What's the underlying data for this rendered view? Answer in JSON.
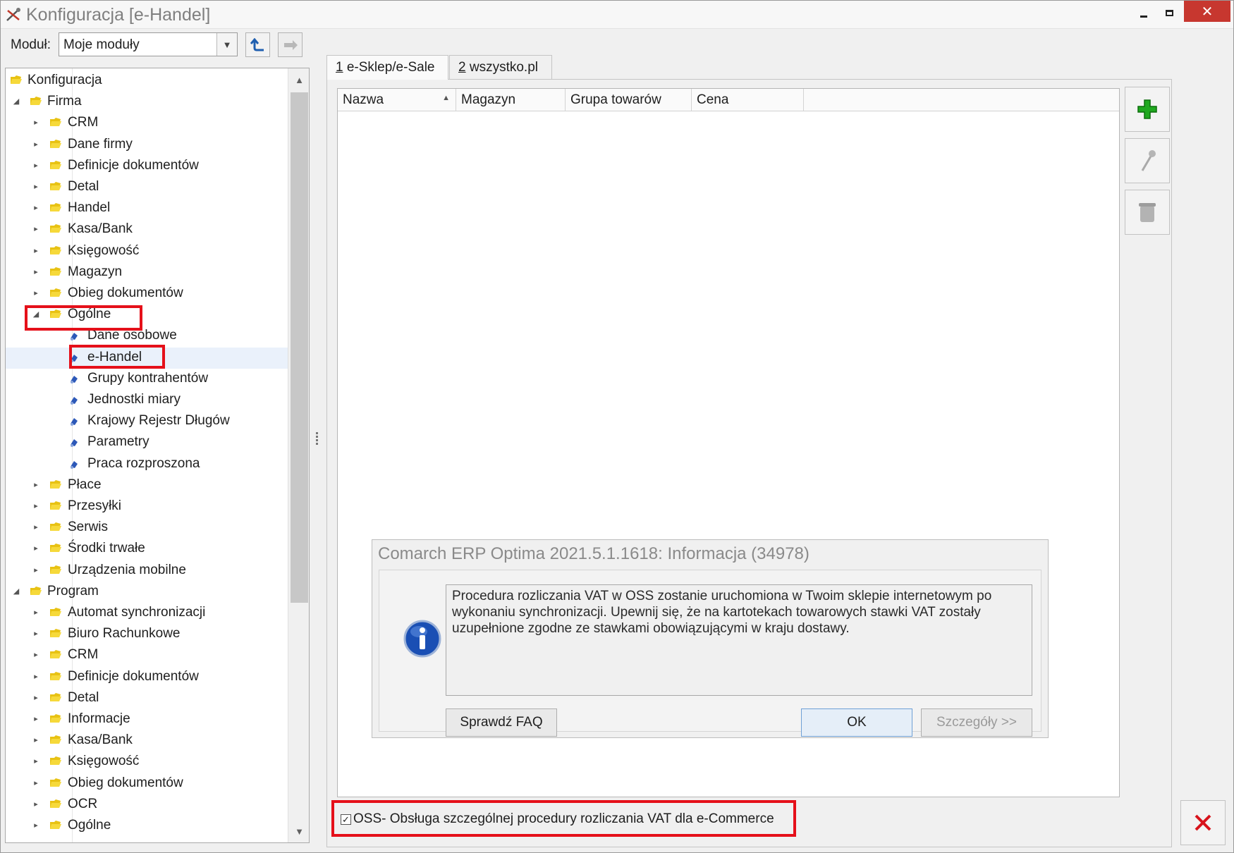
{
  "window": {
    "title": "Konfiguracja [e-Handel]",
    "icon": "tools-icon",
    "controls": [
      "minimize",
      "maximize",
      "close"
    ],
    "close_color": "#c7372f"
  },
  "module": {
    "label": "Moduł:",
    "selected": "Moje moduły"
  },
  "tree": {
    "items": [
      {
        "label": "Konfiguracja",
        "level": 0,
        "expander": "",
        "icon": "folder-icon"
      },
      {
        "label": "Firma",
        "level": 1,
        "expander": "expanded",
        "icon": "folder-icon"
      },
      {
        "label": "CRM",
        "level": 2,
        "expander": "collapsed",
        "icon": "folder-icon"
      },
      {
        "label": "Dane firmy",
        "level": 2,
        "expander": "collapsed",
        "icon": "folder-icon"
      },
      {
        "label": "Definicje dokumentów",
        "level": 2,
        "expander": "collapsed",
        "icon": "folder-icon"
      },
      {
        "label": "Detal",
        "level": 2,
        "expander": "collapsed",
        "icon": "folder-icon"
      },
      {
        "label": "Handel",
        "level": 2,
        "expander": "collapsed",
        "icon": "folder-icon"
      },
      {
        "label": "Kasa/Bank",
        "level": 2,
        "expander": "collapsed",
        "icon": "folder-icon"
      },
      {
        "label": "Księgowość",
        "level": 2,
        "expander": "collapsed",
        "icon": "folder-icon"
      },
      {
        "label": "Magazyn",
        "level": 2,
        "expander": "collapsed",
        "icon": "folder-icon"
      },
      {
        "label": "Obieg dokumentów",
        "level": 2,
        "expander": "collapsed",
        "icon": "folder-icon"
      },
      {
        "label": "Ogólne",
        "level": 2,
        "expander": "expanded",
        "icon": "folder-icon"
      },
      {
        "label": "Dane osobowe",
        "level": 3,
        "expander": "",
        "icon": "leaf-icon"
      },
      {
        "label": "e-Handel",
        "level": 3,
        "expander": "",
        "icon": "leaf-icon",
        "selected": true
      },
      {
        "label": "Grupy kontrahentów",
        "level": 3,
        "expander": "",
        "icon": "leaf-icon"
      },
      {
        "label": "Jednostki miary",
        "level": 3,
        "expander": "",
        "icon": "leaf-icon"
      },
      {
        "label": "Krajowy Rejestr Długów",
        "level": 3,
        "expander": "",
        "icon": "leaf-icon"
      },
      {
        "label": "Parametry",
        "level": 3,
        "expander": "",
        "icon": "leaf-icon"
      },
      {
        "label": "Praca rozproszona",
        "level": 3,
        "expander": "",
        "icon": "leaf-icon"
      },
      {
        "label": "Płace",
        "level": 2,
        "expander": "collapsed",
        "icon": "folder-icon"
      },
      {
        "label": "Przesyłki",
        "level": 2,
        "expander": "collapsed",
        "icon": "folder-icon"
      },
      {
        "label": "Serwis",
        "level": 2,
        "expander": "collapsed",
        "icon": "folder-icon"
      },
      {
        "label": "Środki trwałe",
        "level": 2,
        "expander": "collapsed",
        "icon": "folder-icon"
      },
      {
        "label": "Urządzenia mobilne",
        "level": 2,
        "expander": "collapsed",
        "icon": "folder-icon"
      },
      {
        "label": "Program",
        "level": 1,
        "expander": "expanded",
        "icon": "folder-icon"
      },
      {
        "label": "Automat synchronizacji",
        "level": 2,
        "expander": "collapsed",
        "icon": "folder-icon"
      },
      {
        "label": "Biuro Rachunkowe",
        "level": 2,
        "expander": "collapsed",
        "icon": "folder-icon"
      },
      {
        "label": "CRM",
        "level": 2,
        "expander": "collapsed",
        "icon": "folder-icon"
      },
      {
        "label": "Definicje dokumentów",
        "level": 2,
        "expander": "collapsed",
        "icon": "folder-icon"
      },
      {
        "label": "Detal",
        "level": 2,
        "expander": "collapsed",
        "icon": "folder-icon"
      },
      {
        "label": "Informacje",
        "level": 2,
        "expander": "collapsed",
        "icon": "folder-icon"
      },
      {
        "label": "Kasa/Bank",
        "level": 2,
        "expander": "collapsed",
        "icon": "folder-icon"
      },
      {
        "label": "Księgowość",
        "level": 2,
        "expander": "collapsed",
        "icon": "folder-icon"
      },
      {
        "label": "Obieg dokumentów",
        "level": 2,
        "expander": "collapsed",
        "icon": "folder-icon"
      },
      {
        "label": "OCR",
        "level": 2,
        "expander": "collapsed",
        "icon": "folder-icon"
      },
      {
        "label": "Ogólne",
        "level": 2,
        "expander": "collapsed",
        "icon": "folder-icon"
      }
    ]
  },
  "tabs": [
    {
      "key": "1",
      "label": " e-Sklep/e-Sale",
      "active": true
    },
    {
      "key": "2",
      "label": " wszystko.pl",
      "active": false
    }
  ],
  "grid": {
    "columns": [
      "Nazwa",
      "Magazyn",
      "Grupa towarów",
      "Cena"
    ],
    "sorted_column": "Nazwa",
    "rows": []
  },
  "side_buttons": [
    "add-icon",
    "edit-icon",
    "delete-icon"
  ],
  "oss": {
    "checked": true,
    "label": "OSS- Obsługa szczególnej procedury rozliczania VAT dla e-Commerce"
  },
  "dialog": {
    "title": "Comarch ERP Optima 2021.5.1.1618: Informacja (34978)",
    "icon": "info-icon",
    "message": "Procedura rozliczania VAT w OSS zostanie uruchomiona w Twoim sklepie internetowym po wykonaniu synchronizacji. Upewnij się, że na kartotekach towarowych stawki VAT zostały uzupełnione zgodne ze stawkami obowiązującymi w kraju dostawy.",
    "buttons": {
      "faq": "Sprawdź FAQ",
      "ok": "OK",
      "details": "Szczegóły >>"
    }
  },
  "colors": {
    "highlight": "#e5101a",
    "selection": "#eaf1fb",
    "add_green": "#1fa81f",
    "close_red": "#d8131c"
  }
}
